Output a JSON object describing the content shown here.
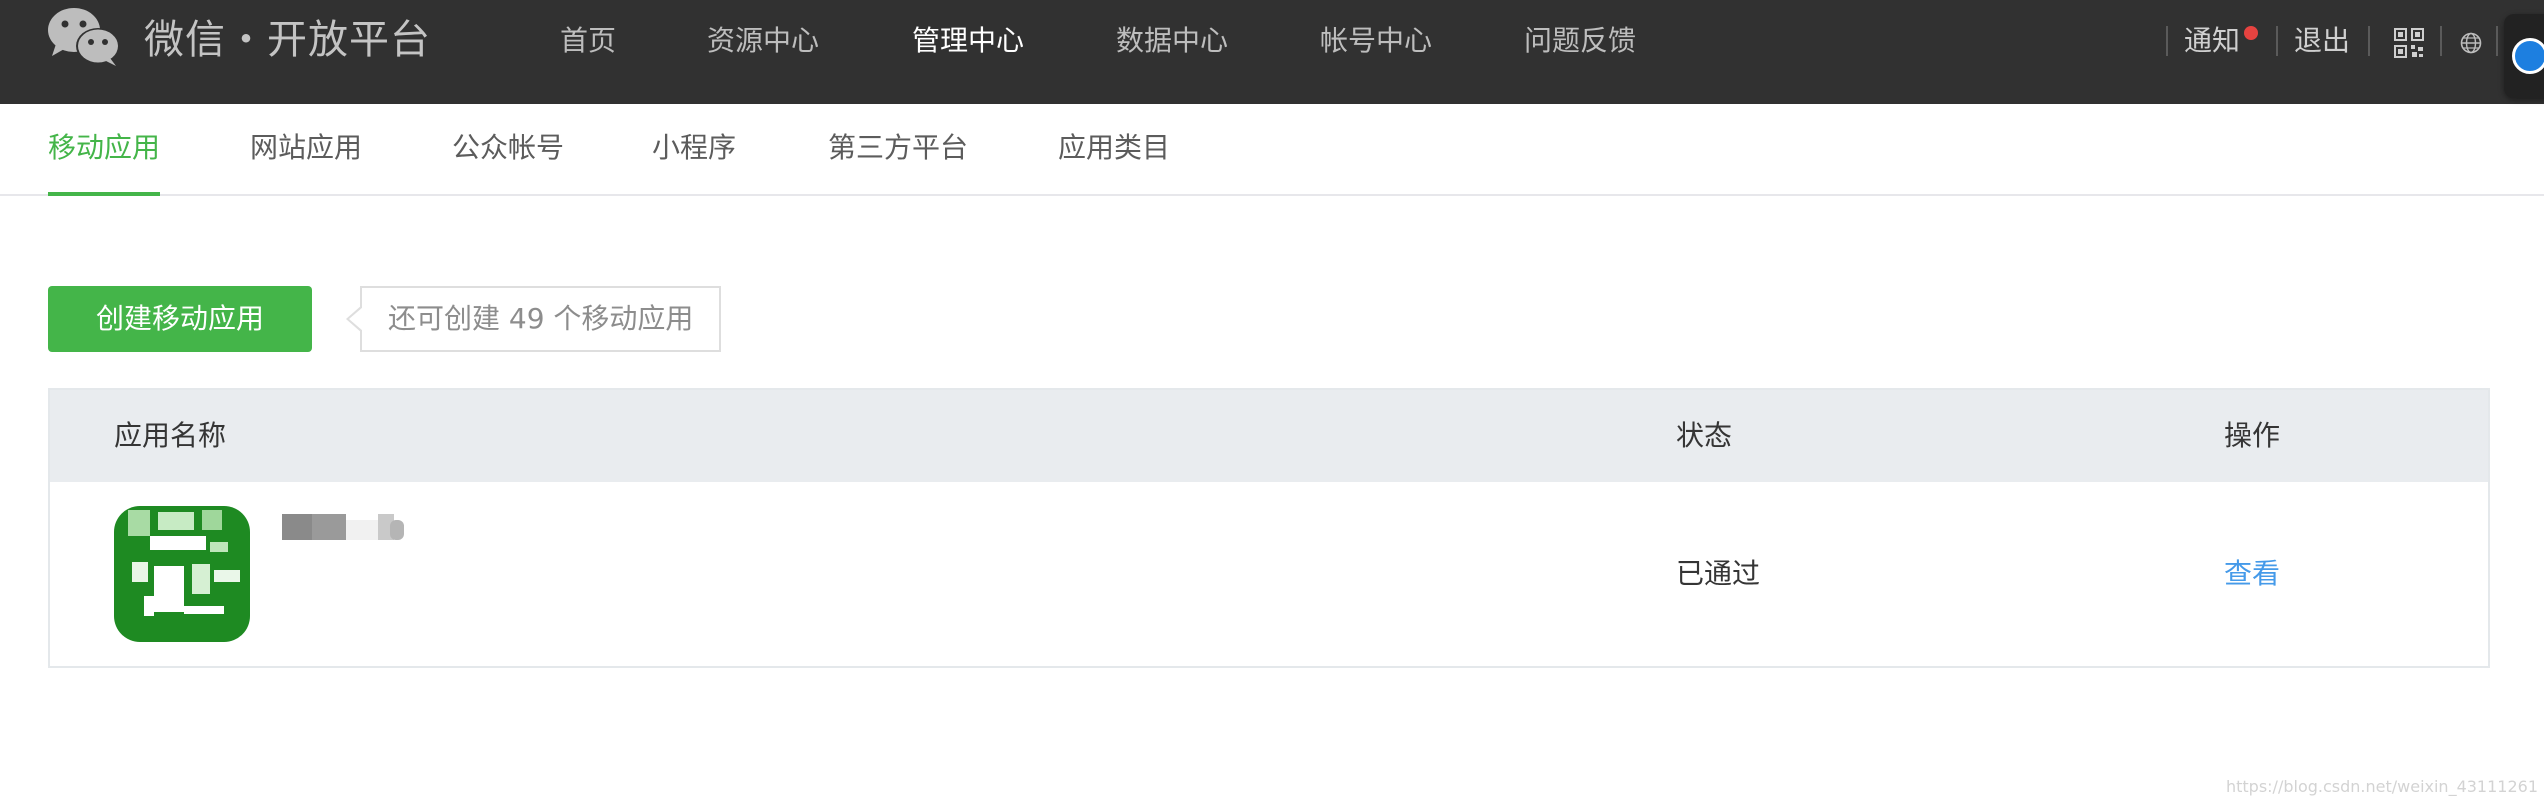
{
  "header": {
    "brand": "微信・开放平台",
    "nav": [
      "首页",
      "资源中心",
      "管理中心",
      "数据中心",
      "帐号中心",
      "问题反馈"
    ],
    "active_nav": "管理中心",
    "notify_label": "通知",
    "logout_label": "退出",
    "icons": [
      "wechat-logo-icon",
      "qrcode-icon",
      "globe-icon",
      "remote-control-icon"
    ]
  },
  "subnav": {
    "tabs": [
      "移动应用",
      "网站应用",
      "公众帐号",
      "小程序",
      "第三方平台",
      "应用类目"
    ],
    "active_tab": "移动应用"
  },
  "actions": {
    "create_label": "创建移动应用",
    "quota_text": "还可创建 49 个移动应用"
  },
  "table": {
    "columns": [
      "应用名称",
      "状态",
      "操作"
    ],
    "rows": [
      {
        "name": "",
        "status": "已通过",
        "action": "查看"
      }
    ]
  },
  "watermark": "https://blog.csdn.net/weixin_43111261",
  "colors": {
    "topbar": "#313131",
    "accent_green": "#44b549",
    "link_blue": "#459ae9",
    "table_header": "#e9ecef"
  }
}
